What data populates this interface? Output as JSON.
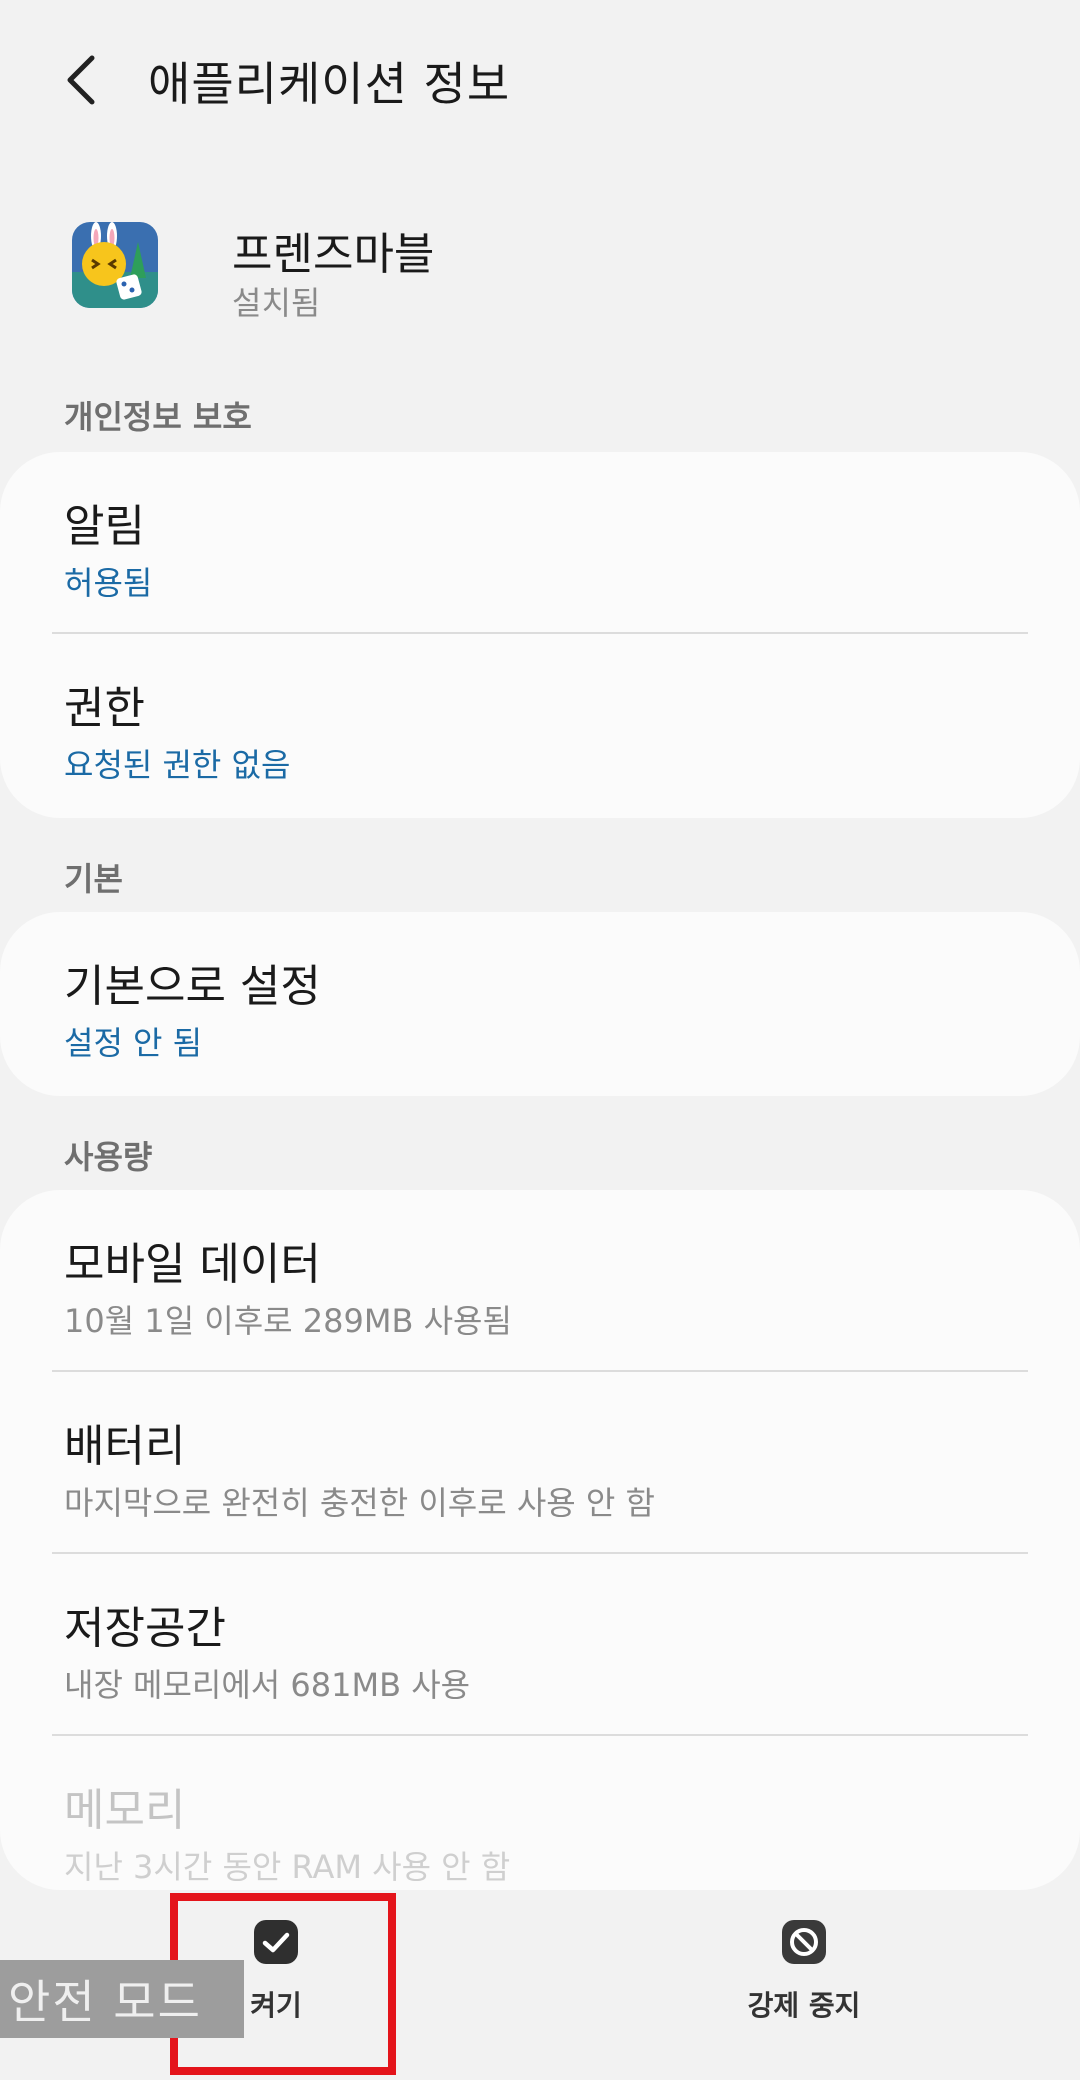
{
  "header": {
    "title": "애플리케이션 정보",
    "back_icon": "back-arrow-icon"
  },
  "app": {
    "name": "프렌즈마블",
    "status": "설치됨",
    "icon": "friends-marble-app-icon"
  },
  "sections": {
    "privacy": {
      "label": "개인정보 보호",
      "items": [
        {
          "title": "알림",
          "subtitle": "허용됨"
        },
        {
          "title": "권한",
          "subtitle": "요청된 권한 없음"
        }
      ]
    },
    "defaults": {
      "label": "기본",
      "items": [
        {
          "title": "기본으로 설정",
          "subtitle": "설정 안 됨"
        }
      ]
    },
    "usage": {
      "label": "사용량",
      "items": [
        {
          "title": "모바일 데이터",
          "subtitle": "10월 1일 이후로 289MB 사용됨"
        },
        {
          "title": "배터리",
          "subtitle": "마지막으로 완전히 충전한 이후로 사용 안 함"
        },
        {
          "title": "저장공간",
          "subtitle": "내장 메모리에서 681MB 사용"
        },
        {
          "title": "메모리",
          "subtitle": "지난 3시간 동안 RAM 사용 안 함"
        }
      ]
    }
  },
  "bottom_bar": {
    "enable_label": "켜기",
    "force_stop_label": "강제 중지"
  },
  "overlay": {
    "safe_mode": "안전 모드"
  },
  "colors": {
    "accent_blue": "#1b6aa5",
    "highlight_red": "#e4141b"
  }
}
